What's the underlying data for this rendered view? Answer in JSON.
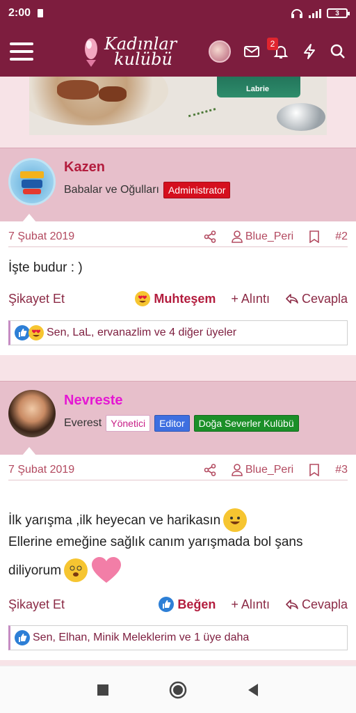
{
  "status": {
    "time": "2:00",
    "battery": "3"
  },
  "header": {
    "logo_line1": "Kadınlar",
    "logo_line2": "kulübü",
    "notification_count": "2"
  },
  "top_image": {
    "brand": "Labrie"
  },
  "posts": [
    {
      "username": "Kazen",
      "username_color": "#b31d3e",
      "user_title": "Babalar ve Oğulları",
      "tags": [
        "Administrator"
      ],
      "date": "7 Şubat 2019",
      "author": "Blue_Peri",
      "number": "#2",
      "content": "İşte budur : )",
      "report": "Şikayet Et",
      "reaction_label": "Muhteşem",
      "quote": "Alıntı",
      "reply": "Cevapla",
      "reactions_text": "Sen, LaL, ervanazlim ve 4 diğer üyeler"
    },
    {
      "username": "Nevreste",
      "username_color": "#e517d3",
      "user_title": "Everest",
      "tags": [
        "Yönetici",
        "Editor",
        "Doğa Severler Kulübü"
      ],
      "date": "7 Şubat 2019",
      "author": "Blue_Peri",
      "number": "#3",
      "content_line1": "İlk yarışma ,ilk heyecan ve harikasın",
      "content_line2": "Ellerine emeğine sağlık canım yarışmada bol şans",
      "content_line3": "diliyorum",
      "report": "Şikayet Et",
      "reaction_label": "Beğen",
      "quote": "Alıntı",
      "reply": "Cevapla",
      "reactions_text": "Sen, Elhan, Minik Meleklerim ve 1 üye daha"
    }
  ],
  "colors": {
    "header": "#7d1d3e",
    "accent": "#b31d3e",
    "post_header": "#e7bfcb"
  }
}
